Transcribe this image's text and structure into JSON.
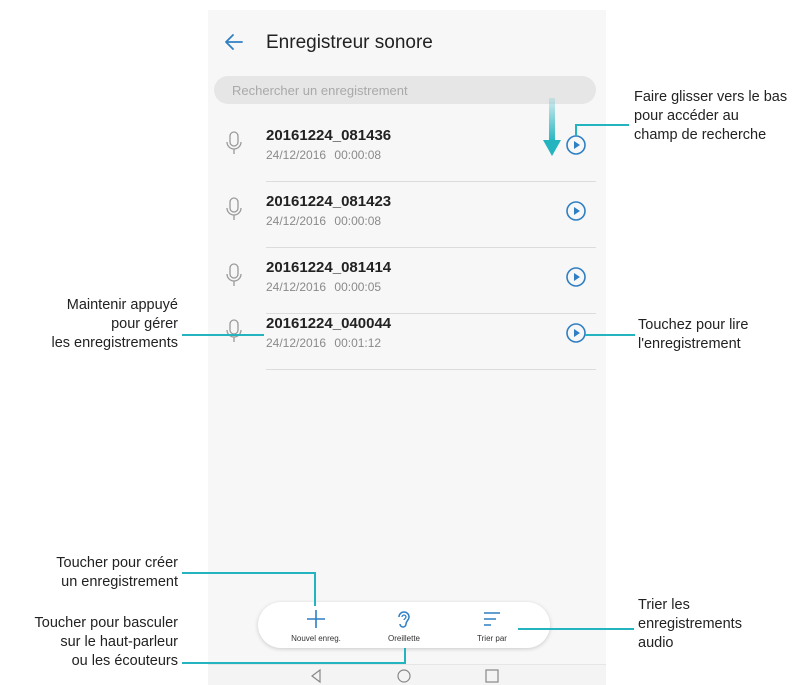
{
  "app": {
    "title": "Enregistreur sonore",
    "search_placeholder": "Rechercher un enregistrement"
  },
  "recordings": [
    {
      "name": "20161224_081436",
      "meta": "24/12/2016 00:00:08"
    },
    {
      "name": "20161224_081423",
      "meta": "24/12/2016 00:00:08"
    },
    {
      "name": "20161224_081414",
      "meta": "24/12/2016 00:00:05"
    },
    {
      "name": "20161224_040044",
      "meta": "24/12/2016 00:01:12"
    }
  ],
  "bottom_bar": {
    "new_label": "Nouvel enreg.",
    "earpiece_label": "Oreillette",
    "sort_label": "Trier par"
  },
  "callouts": {
    "swipe": [
      "Faire glisser vers le bas",
      "pour accéder au",
      "champ de recherche"
    ],
    "hold": [
      "Maintenir appuyé",
      "pour gérer",
      "les enregistrements"
    ],
    "play": [
      "Touchez pour lire",
      "l'enregistrement"
    ],
    "create": [
      "Toucher pour créer",
      "un enregistrement"
    ],
    "toggle": [
      "Toucher pour basculer",
      "sur le haut-parleur",
      "ou les écouteurs"
    ],
    "sort": [
      "Trier les",
      "enregistrements",
      "audio"
    ]
  },
  "colors": {
    "accent": "#2f7fc4",
    "callout_line": "#23b4c0"
  }
}
